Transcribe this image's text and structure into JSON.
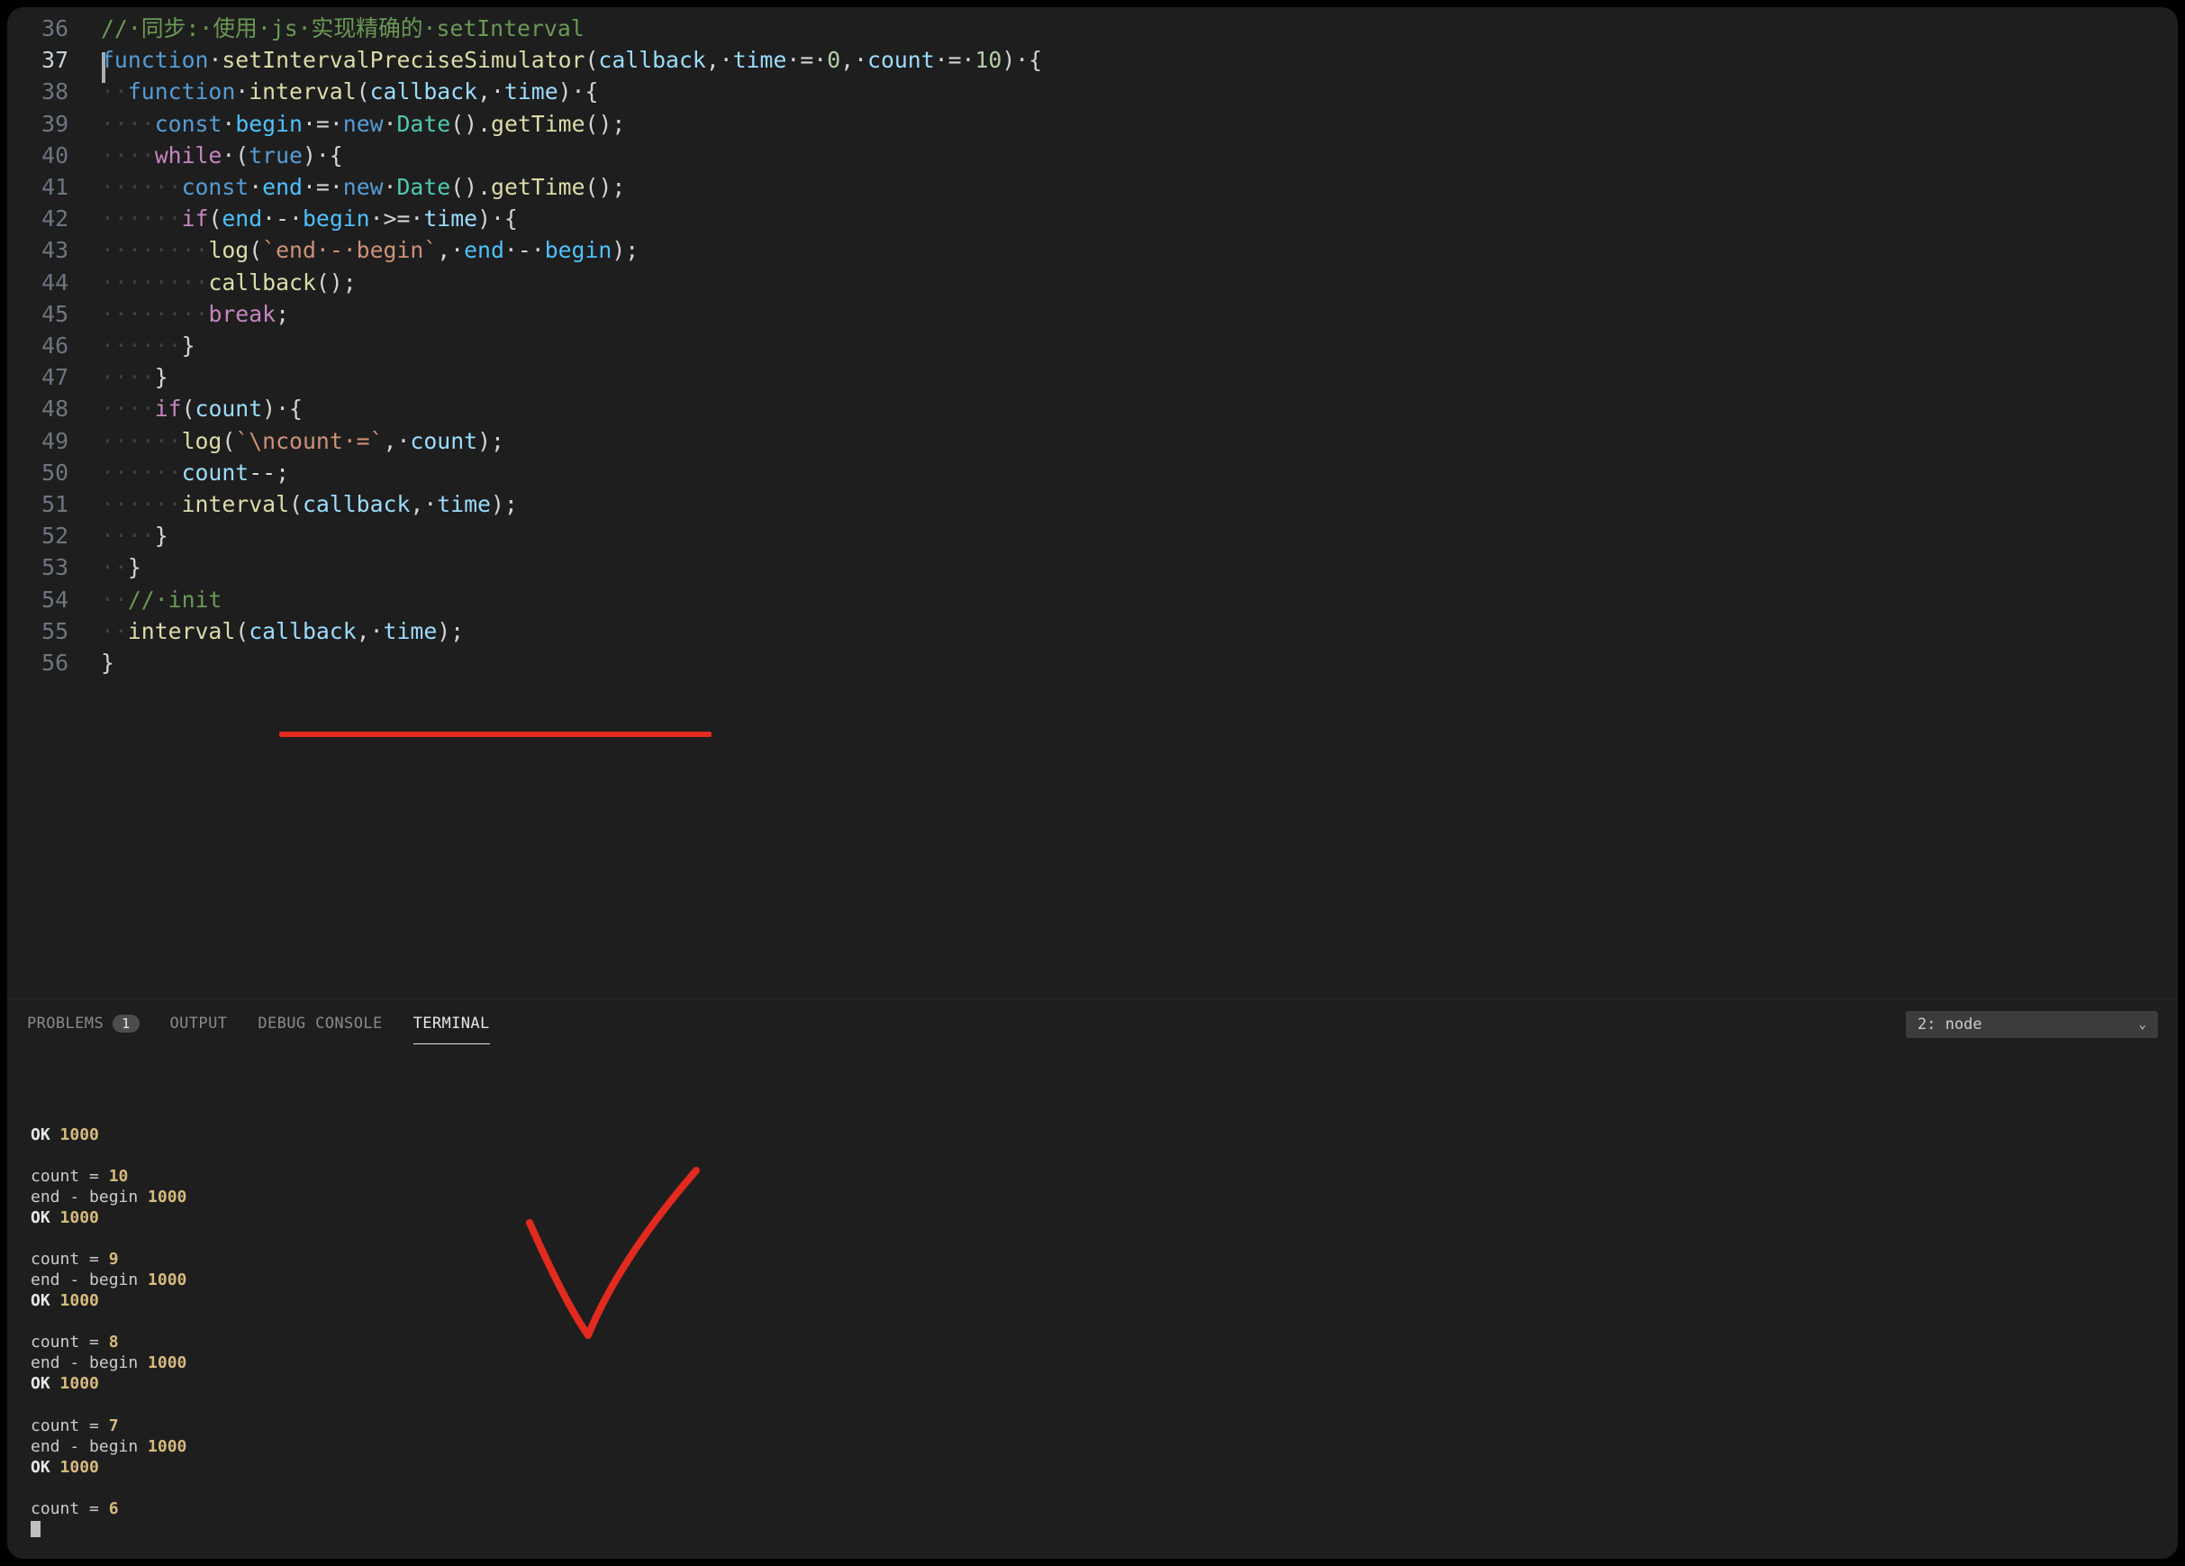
{
  "editor": {
    "lines": [
      {
        "n": 36,
        "tokens": [
          [
            "// 同步: 使用 js 实现精确的 setInterval",
            "c-comment"
          ]
        ],
        "indent": 0
      },
      {
        "n": 37,
        "active": true,
        "indent": 0,
        "tokens": [
          [
            "function",
            "c-keyword"
          ],
          [
            " ",
            "c-plain"
          ],
          [
            "setIntervalPreciseSimulator",
            "c-func"
          ],
          [
            "(",
            "c-plain"
          ],
          [
            "callback",
            "c-param"
          ],
          [
            ", ",
            "c-plain"
          ],
          [
            "time",
            "c-param"
          ],
          [
            " = ",
            "c-plain"
          ],
          [
            "0",
            "c-num"
          ],
          [
            ", ",
            "c-plain"
          ],
          [
            "count",
            "c-param"
          ],
          [
            " = ",
            "c-plain"
          ],
          [
            "10",
            "c-num"
          ],
          [
            ") {",
            "c-plain"
          ]
        ]
      },
      {
        "n": 38,
        "indent": 1,
        "tokens": [
          [
            "function",
            "c-keyword"
          ],
          [
            " ",
            "c-plain"
          ],
          [
            "interval",
            "c-func"
          ],
          [
            "(",
            "c-plain"
          ],
          [
            "callback",
            "c-param"
          ],
          [
            ", ",
            "c-plain"
          ],
          [
            "time",
            "c-param"
          ],
          [
            ") {",
            "c-plain"
          ]
        ]
      },
      {
        "n": 39,
        "indent": 2,
        "tokens": [
          [
            "const",
            "c-keyword"
          ],
          [
            " ",
            "c-plain"
          ],
          [
            "begin",
            "c-const"
          ],
          [
            " = ",
            "c-plain"
          ],
          [
            "new",
            "c-keyword"
          ],
          [
            " ",
            "c-plain"
          ],
          [
            "Date",
            "c-type"
          ],
          [
            "().",
            "c-plain"
          ],
          [
            "getTime",
            "c-func"
          ],
          [
            "();",
            "c-plain"
          ]
        ]
      },
      {
        "n": 40,
        "indent": 2,
        "tokens": [
          [
            "while",
            "c-keyword2"
          ],
          [
            " (",
            "c-plain"
          ],
          [
            "true",
            "c-keyword"
          ],
          [
            ") {",
            "c-plain"
          ]
        ]
      },
      {
        "n": 41,
        "indent": 3,
        "tokens": [
          [
            "const",
            "c-keyword"
          ],
          [
            " ",
            "c-plain"
          ],
          [
            "end",
            "c-const"
          ],
          [
            " = ",
            "c-plain"
          ],
          [
            "new",
            "c-keyword"
          ],
          [
            " ",
            "c-plain"
          ],
          [
            "Date",
            "c-type"
          ],
          [
            "().",
            "c-plain"
          ],
          [
            "getTime",
            "c-func"
          ],
          [
            "();",
            "c-plain"
          ]
        ]
      },
      {
        "n": 42,
        "indent": 3,
        "tokens": [
          [
            "if",
            "c-keyword2"
          ],
          [
            "(",
            "c-plain"
          ],
          [
            "end",
            "c-const"
          ],
          [
            " - ",
            "c-plain"
          ],
          [
            "begin",
            "c-const"
          ],
          [
            " >= ",
            "c-plain"
          ],
          [
            "time",
            "c-var"
          ],
          [
            ") {",
            "c-plain"
          ]
        ]
      },
      {
        "n": 43,
        "indent": 4,
        "tokens": [
          [
            "log",
            "c-func"
          ],
          [
            "(",
            "c-plain"
          ],
          [
            "`end - begin`",
            "c-string"
          ],
          [
            ", ",
            "c-plain"
          ],
          [
            "end",
            "c-const"
          ],
          [
            " - ",
            "c-plain"
          ],
          [
            "begin",
            "c-const"
          ],
          [
            ");",
            "c-plain"
          ]
        ]
      },
      {
        "n": 44,
        "indent": 4,
        "tokens": [
          [
            "callback",
            "c-func"
          ],
          [
            "();",
            "c-plain"
          ]
        ]
      },
      {
        "n": 45,
        "indent": 4,
        "tokens": [
          [
            "break",
            "c-keyword2"
          ],
          [
            ";",
            "c-plain"
          ]
        ]
      },
      {
        "n": 46,
        "indent": 3,
        "tokens": [
          [
            "}",
            "c-plain"
          ]
        ]
      },
      {
        "n": 47,
        "indent": 2,
        "tokens": [
          [
            "}",
            "c-plain"
          ]
        ]
      },
      {
        "n": 48,
        "indent": 2,
        "tokens": [
          [
            "if",
            "c-keyword2"
          ],
          [
            "(",
            "c-plain"
          ],
          [
            "count",
            "c-var"
          ],
          [
            ") {",
            "c-plain"
          ]
        ]
      },
      {
        "n": 49,
        "indent": 3,
        "tokens": [
          [
            "log",
            "c-func"
          ],
          [
            "(",
            "c-plain"
          ],
          [
            "`\\ncount =`",
            "c-string"
          ],
          [
            ", ",
            "c-plain"
          ],
          [
            "count",
            "c-var"
          ],
          [
            ");",
            "c-plain"
          ]
        ]
      },
      {
        "n": 50,
        "indent": 3,
        "tokens": [
          [
            "count",
            "c-var"
          ],
          [
            "--;",
            "c-plain"
          ]
        ]
      },
      {
        "n": 51,
        "indent": 3,
        "tokens": [
          [
            "interval",
            "c-func"
          ],
          [
            "(",
            "c-plain"
          ],
          [
            "callback",
            "c-var"
          ],
          [
            ", ",
            "c-plain"
          ],
          [
            "time",
            "c-var"
          ],
          [
            ");",
            "c-plain"
          ]
        ]
      },
      {
        "n": 52,
        "indent": 2,
        "tokens": [
          [
            "}",
            "c-plain"
          ]
        ]
      },
      {
        "n": 53,
        "indent": 1,
        "tokens": [
          [
            "}",
            "c-plain"
          ]
        ]
      },
      {
        "n": 54,
        "indent": 1,
        "tokens": [
          [
            "// init",
            "c-comment"
          ]
        ]
      },
      {
        "n": 55,
        "indent": 1,
        "tokens": [
          [
            "interval",
            "c-func"
          ],
          [
            "(",
            "c-plain"
          ],
          [
            "callback",
            "c-var"
          ],
          [
            ", ",
            "c-plain"
          ],
          [
            "time",
            "c-var"
          ],
          [
            ");",
            "c-plain"
          ]
        ]
      },
      {
        "n": 56,
        "indent": 0,
        "tokens": [
          [
            "}",
            "c-plain"
          ]
        ]
      }
    ]
  },
  "panel": {
    "tabs": {
      "problems": "PROBLEMS",
      "problems_badge": "1",
      "output": "OUTPUT",
      "debug": "DEBUG CONSOLE",
      "terminal": "TERMINAL"
    },
    "dropdown": "2: node"
  },
  "terminal": {
    "blocks": [
      [
        [
          "OK ",
          "t-bold"
        ],
        [
          "1000",
          "t-yellow"
        ]
      ],
      [],
      [
        [
          "count = ",
          "t-dim"
        ],
        [
          "10",
          "t-yellow"
        ]
      ],
      [
        [
          "end - begin ",
          "t-dim"
        ],
        [
          "1000",
          "t-yellow"
        ]
      ],
      [
        [
          "OK ",
          "t-bold"
        ],
        [
          "1000",
          "t-yellow"
        ]
      ],
      [],
      [
        [
          "count = ",
          "t-dim"
        ],
        [
          "9",
          "t-yellow"
        ]
      ],
      [
        [
          "end - begin ",
          "t-dim"
        ],
        [
          "1000",
          "t-yellow"
        ]
      ],
      [
        [
          "OK ",
          "t-bold"
        ],
        [
          "1000",
          "t-yellow"
        ]
      ],
      [],
      [
        [
          "count = ",
          "t-dim"
        ],
        [
          "8",
          "t-yellow"
        ]
      ],
      [
        [
          "end - begin ",
          "t-dim"
        ],
        [
          "1000",
          "t-yellow"
        ]
      ],
      [
        [
          "OK ",
          "t-bold"
        ],
        [
          "1000",
          "t-yellow"
        ]
      ],
      [],
      [
        [
          "count = ",
          "t-dim"
        ],
        [
          "7",
          "t-yellow"
        ]
      ],
      [
        [
          "end - begin ",
          "t-dim"
        ],
        [
          "1000",
          "t-yellow"
        ]
      ],
      [
        [
          "OK ",
          "t-bold"
        ],
        [
          "1000",
          "t-yellow"
        ]
      ],
      [],
      [
        [
          "count = ",
          "t-dim"
        ],
        [
          "6",
          "t-yellow"
        ]
      ]
    ]
  },
  "annotations": {
    "underline_color": "#e22a1f",
    "checkmark_color": "#e22a1f"
  }
}
